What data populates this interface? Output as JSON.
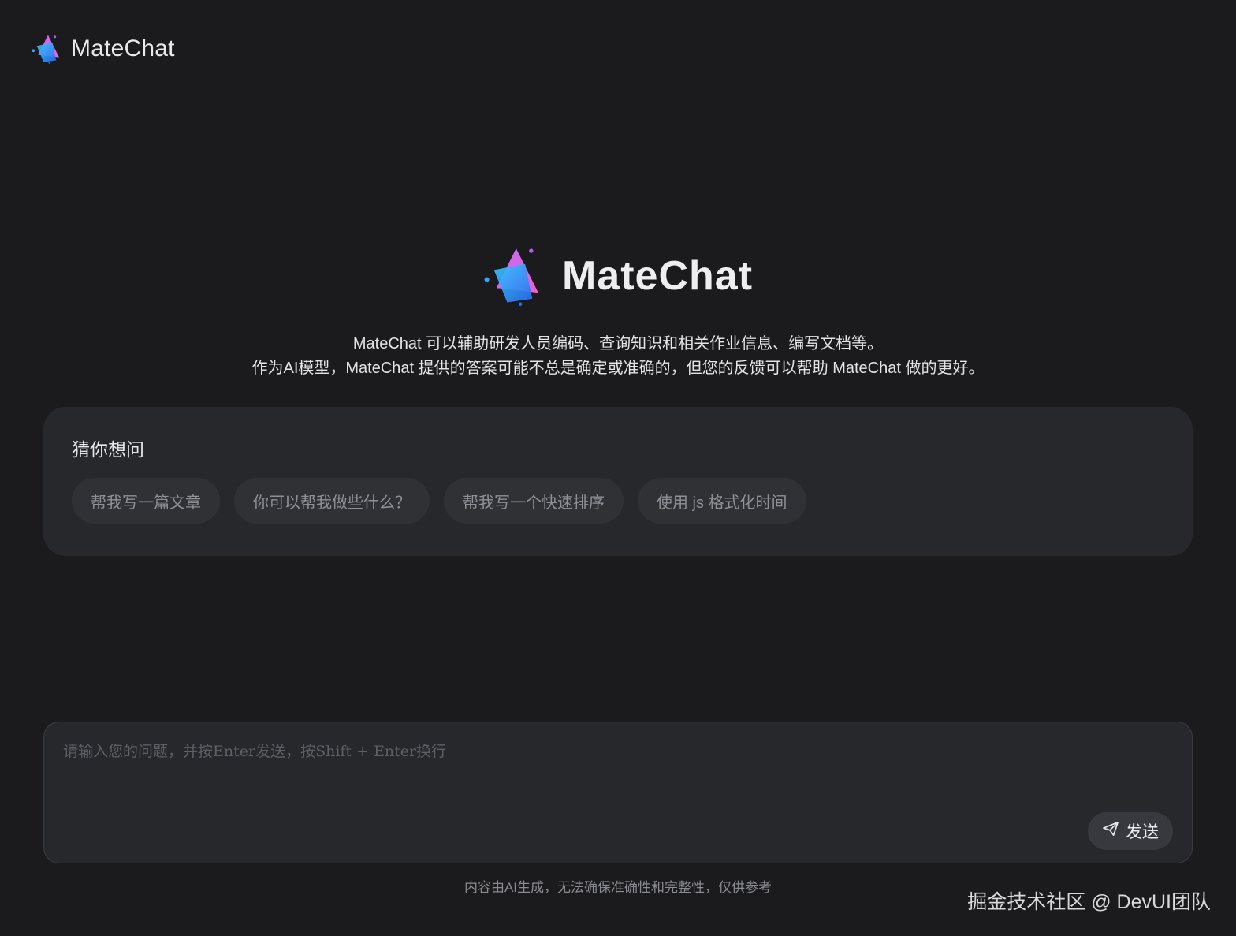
{
  "header": {
    "app_name": "MateChat",
    "logo_icon": "matechat-logo-icon"
  },
  "hero": {
    "title": "MateChat",
    "logo_icon": "matechat-logo-icon"
  },
  "intro": {
    "line1": "MateChat 可以辅助研发人员编码、查询知识和相关作业信息、编写文档等。",
    "line2": "作为AI模型，MateChat 提供的答案可能不总是确定或准确的，但您的反馈可以帮助 MateChat 做的更好。"
  },
  "guess": {
    "title": "猜你想问",
    "items": [
      {
        "label": "帮我写一篇文章"
      },
      {
        "label": "你可以帮我做些什么？"
      },
      {
        "label": "帮我写一个快速排序"
      },
      {
        "label": "使用 js 格式化时间"
      }
    ]
  },
  "input": {
    "placeholder": "请输入您的问题，并按Enter发送，按Shift + Enter换行",
    "value": "",
    "send_label": "发送",
    "send_icon": "send-icon"
  },
  "disclaimer": "内容由AI生成，无法确保准确性和完整性，仅供参考",
  "watermark": "掘金技术社区 @ DevUI团队",
  "colors": {
    "background": "#1b1b1d",
    "panel": "#27282b",
    "chip": "#303135",
    "logo_blue": "#3aa0ff",
    "logo_purple": "#b45ef5",
    "logo_pink": "#f25fd0"
  }
}
